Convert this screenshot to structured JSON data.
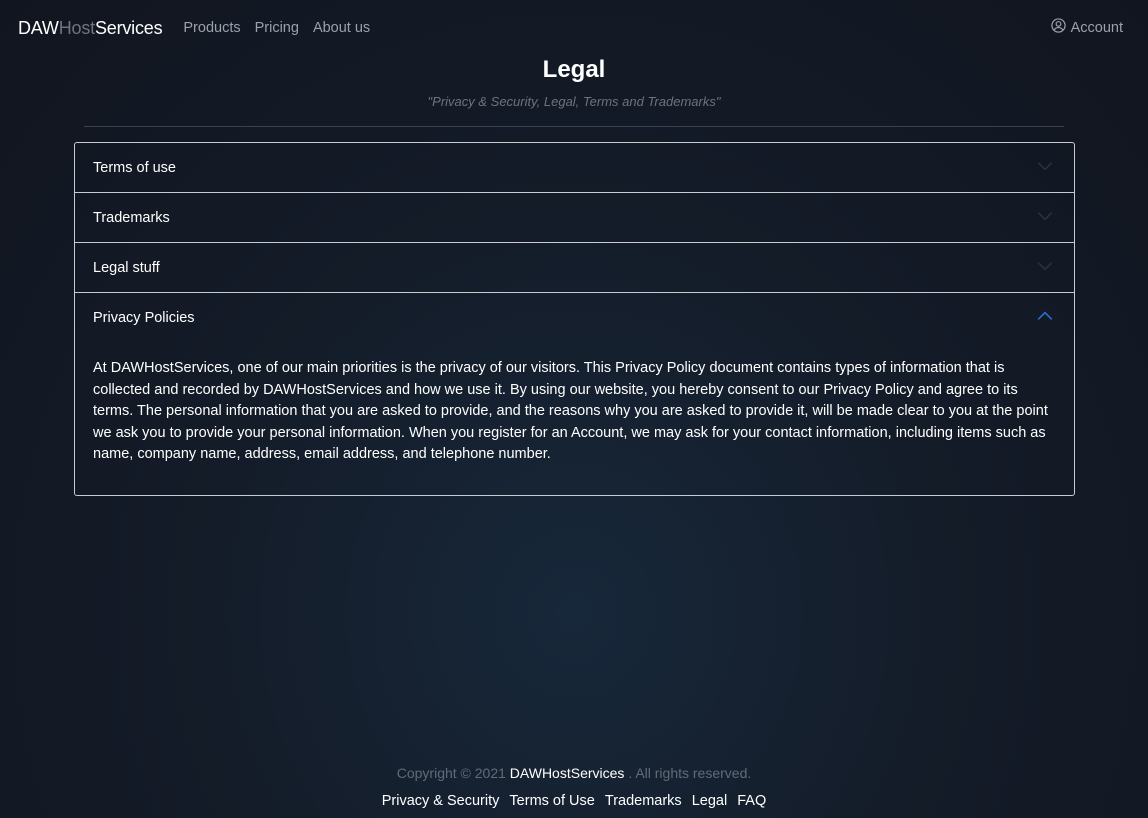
{
  "navbar": {
    "brand": {
      "part1": "DAW",
      "part2": "Host",
      "part3": "Services"
    },
    "links": [
      "Products",
      "Pricing",
      "About us"
    ],
    "account_label": "Account",
    "account_icon": "user-circle-icon"
  },
  "page": {
    "title": "Legal",
    "subtitle": "\"Privacy & Security, Legal, Terms and Trademarks\""
  },
  "accordion": {
    "items": [
      {
        "label": "Terms of use",
        "expanded": false
      },
      {
        "label": "Trademarks",
        "expanded": false
      },
      {
        "label": "Legal stuff",
        "expanded": false
      },
      {
        "label": "Privacy Policies",
        "expanded": true,
        "body": "At DAWHostServices, one of our main priorities is the privacy of our visitors. This Privacy Policy document contains types of information that is collected and recorded by DAWHostServices and how we use it. By using our website, you hereby consent to our Privacy Policy and agree to its terms. The personal information that you are asked to provide, and the reasons why you are asked to provide it, will be made clear to you at the point we ask you to provide your personal information. When you register for an Account, we may ask for your contact information, including items such as name, company name, address, email address, and telephone number."
      }
    ],
    "collapsed_chevron_color": "#2a3140",
    "expanded_chevron_color": "#2f6fdb"
  },
  "footer": {
    "copyright_prefix": "Copyright © 2021",
    "copyright_brand": "DAWHostServices",
    "copyright_suffix": ". All rights reserved.",
    "links": [
      "Privacy & Security",
      "Terms of Use",
      "Trademarks",
      "Legal",
      "FAQ"
    ]
  }
}
